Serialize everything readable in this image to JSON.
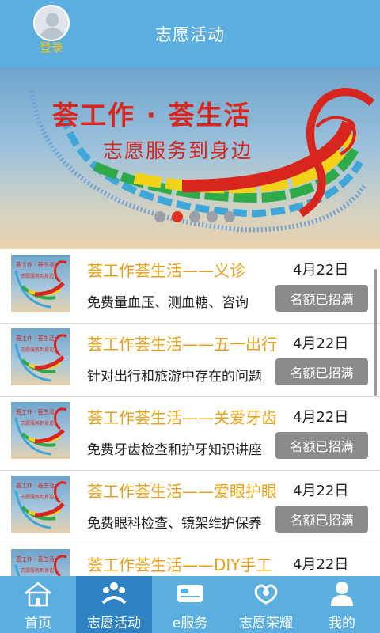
{
  "header": {
    "login_label": "登录",
    "title": "志愿活动"
  },
  "banner": {
    "title": "荟工作 · 荟生活",
    "subtitle": "志愿服务到身边",
    "slide_count": 5,
    "active_slide": 2
  },
  "list": {
    "items": [
      {
        "title": "荟工作荟生活——义诊",
        "date": "4月22日",
        "desc": "免费量血压、测血糖、咨询",
        "status": "名额已招满",
        "thumb_line1": "荟工作 · 荟生活",
        "thumb_line2": "志愿服务到身边"
      },
      {
        "title": "荟工作荟生活——五一出行",
        "date": "4月22日",
        "desc": "针对出行和旅游中存在的问题",
        "status": "名额已招满",
        "thumb_line1": "荟工作 · 荟生活",
        "thumb_line2": "志愿服务到身边"
      },
      {
        "title": "荟工作荟生活——关爱牙齿",
        "date": "4月22日",
        "desc": "免费牙齿检查和护牙知识讲座",
        "status": "名额已招满",
        "thumb_line1": "荟工作 · 荟生活",
        "thumb_line2": "志愿服务到身边"
      },
      {
        "title": "荟工作荟生活——爱眼护眼",
        "date": "4月22日",
        "desc": "免费眼科检查、镜架维护保养",
        "status": "名额已招满",
        "thumb_line1": "荟工作 · 荟生活",
        "thumb_line2": "志愿服务到身边"
      },
      {
        "title": "荟工作荟生活——DIY手工",
        "date": "4月22日",
        "desc": "",
        "status": "",
        "thumb_line1": "荟工作 · 荟生活",
        "thumb_line2": "志愿服务到身边"
      }
    ]
  },
  "tabbar": {
    "tabs": [
      {
        "label": "首页",
        "icon": "home-icon"
      },
      {
        "label": "志愿活动",
        "icon": "volunteer-icon"
      },
      {
        "label": "e服务",
        "icon": "card-icon"
      },
      {
        "label": "志愿荣耀",
        "icon": "honor-icon"
      },
      {
        "label": "我的",
        "icon": "user-icon"
      }
    ],
    "active_index": 1
  },
  "colors": {
    "header_bg": "#5aaee0",
    "tab_active_bg": "#2e83c4",
    "title_orange": "#e6a11c",
    "banner_red": "#d8261e",
    "status_gray": "#8b8b8b",
    "login_yellow": "#f5c21a"
  }
}
